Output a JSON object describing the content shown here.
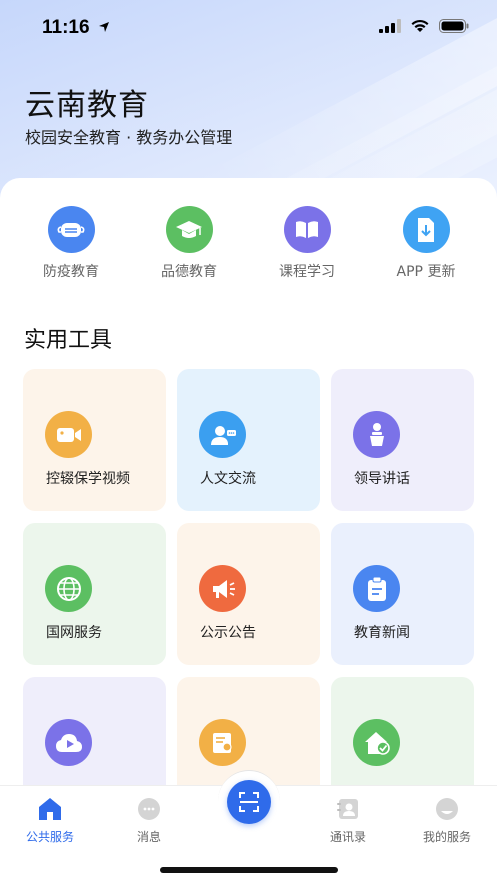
{
  "status": {
    "time": "11:16"
  },
  "header": {
    "title": "云南教育",
    "subtitle": "校园安全教育 · 教务办公管理"
  },
  "quick_actions": [
    {
      "label": "防疫教育",
      "icon": "mask-icon",
      "color": "#4a86f0"
    },
    {
      "label": "品德教育",
      "icon": "graduation-cap-icon",
      "color": "#5cbf62"
    },
    {
      "label": "课程学习",
      "icon": "book-icon",
      "color": "#7b72e8"
    },
    {
      "label": "APP 更新",
      "icon": "download-icon",
      "color": "#3fa3f3"
    }
  ],
  "tools": {
    "title": "实用工具",
    "items": [
      {
        "label": "控辍保学视频",
        "icon": "video-camera-icon"
      },
      {
        "label": "人文交流",
        "icon": "chat-user-icon"
      },
      {
        "label": "领导讲话",
        "icon": "podium-speaker-icon"
      },
      {
        "label": "国网服务",
        "icon": "globe-icon"
      },
      {
        "label": "公示公告",
        "icon": "megaphone-icon"
      },
      {
        "label": "教育新闻",
        "icon": "clipboard-icon"
      },
      {
        "label": "",
        "icon": "cloud-play-icon"
      },
      {
        "label": "",
        "icon": "certificate-icon"
      },
      {
        "label": "",
        "icon": "home-check-icon"
      }
    ]
  },
  "tabbar": {
    "tabs": [
      {
        "label": "公共服务",
        "icon": "home-icon",
        "active": true
      },
      {
        "label": "消息",
        "icon": "message-icon"
      },
      {
        "label": "",
        "icon": "scan-icon"
      },
      {
        "label": "通讯录",
        "icon": "contacts-icon"
      },
      {
        "label": "我的服务",
        "icon": "profile-icon"
      }
    ]
  },
  "colors": {
    "accent": "#2f6bea"
  }
}
